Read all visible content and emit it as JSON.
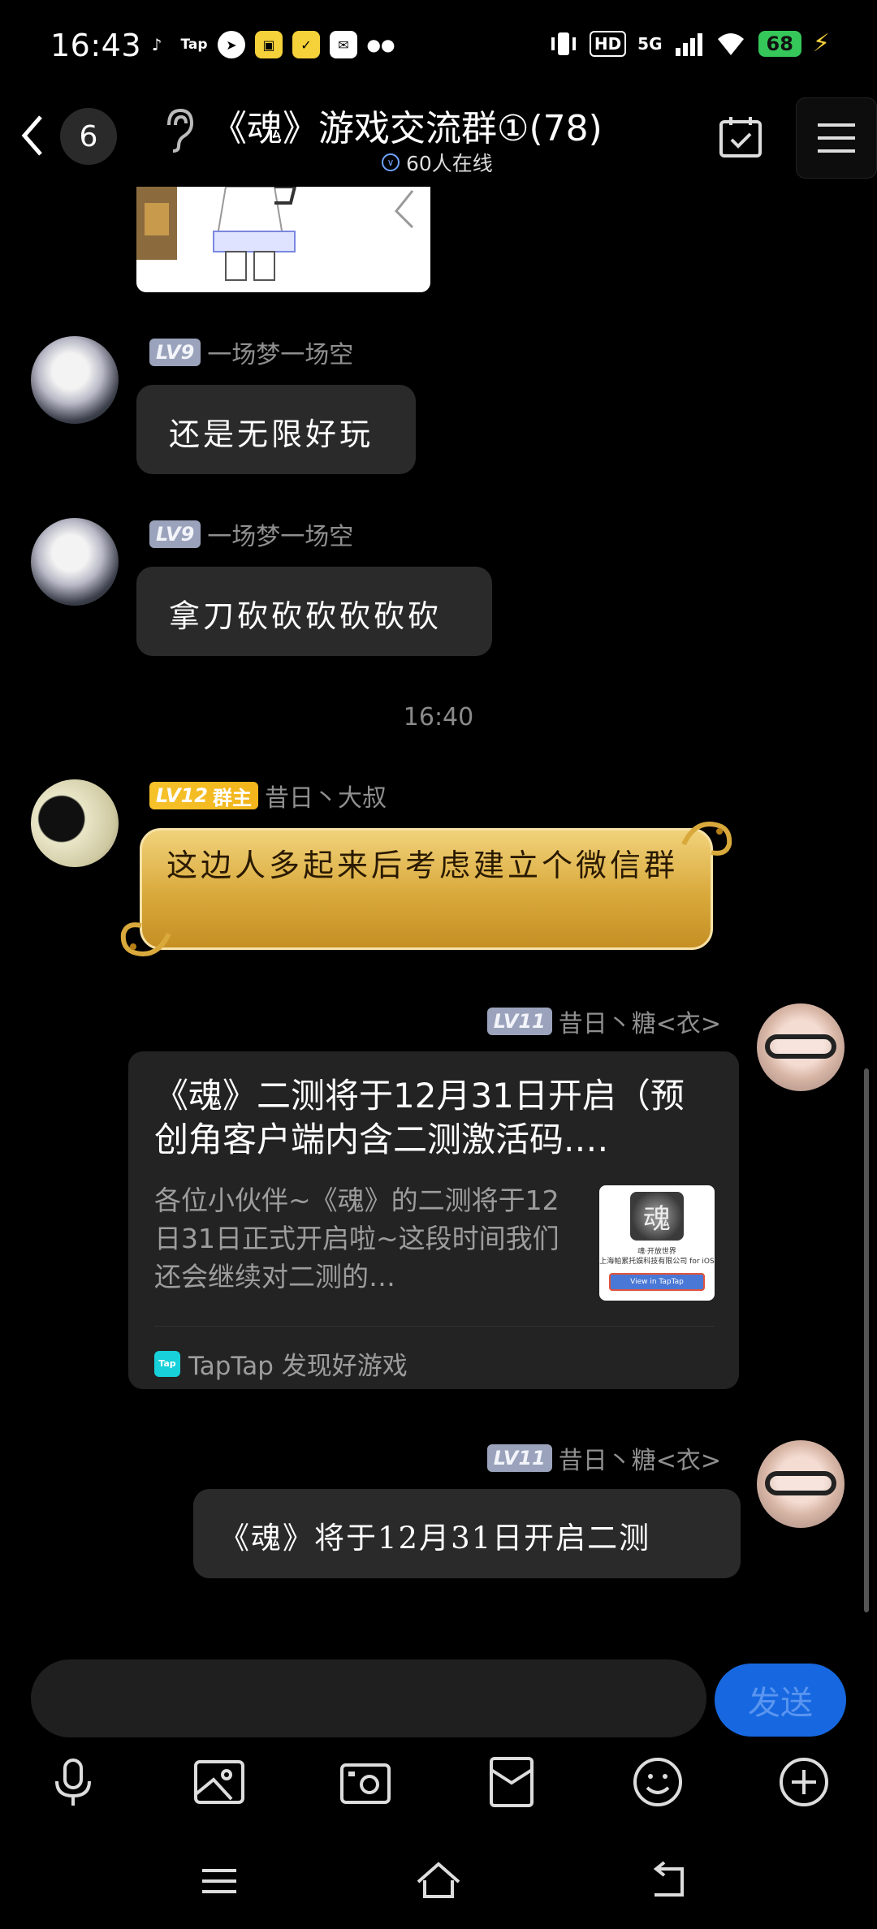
{
  "status_bar": {
    "time": "16:43",
    "apps": [
      "tiktok-icon",
      "Tap",
      "speed-icon",
      "eleme-icon",
      "Q",
      "mail-icon",
      "wechat-icon"
    ],
    "app_tap_label": "Tap",
    "hd_label": "HD",
    "network_label": "5G",
    "battery": "68"
  },
  "header": {
    "unread_count": "6",
    "title": "《魂》游戏交流群①(78)",
    "online": "60人在线"
  },
  "messages": [
    {
      "level": "LV9",
      "name": "一场梦一场空",
      "text": "还是无限好玩"
    },
    {
      "level": "LV9",
      "name": "一场梦一场空",
      "text": "拿刀砍砍砍砍砍砍"
    },
    {
      "timestamp": "16:40"
    },
    {
      "level": "LV12",
      "role": "群主",
      "name": "昔日丶大叔",
      "text": "这边人多起来后考虑建立个微信群"
    },
    {
      "level": "LV11",
      "name": "昔日丶糖<衣>",
      "card": {
        "title": "《魂》二测将于12月31日开启（预创角客户端内含二测激活码.…",
        "description": "各位小伙伴~《魂》的二测将于12日31日正式开启啦~这段时间我们还会继续对二测的…",
        "thumb_char": "魂",
        "thumb_line1": "魂·开放世界",
        "thumb_line2": "上海帕累托娱科技有限公司 for iOS",
        "thumb_button": "View in TapTap",
        "source_logo": "Tap",
        "source": "TapTap 发现好游戏"
      }
    },
    {
      "level": "LV11",
      "name": "昔日丶糖<衣>",
      "text": "《魂》将于12月31日开启二测"
    }
  ],
  "input": {
    "placeholder": "",
    "send_label": "发送"
  },
  "toolbar": [
    "microphone-icon",
    "image-icon",
    "camera-icon",
    "red-packet-icon",
    "emoji-icon",
    "plus-icon"
  ],
  "colors": {
    "accent": "#1768e0",
    "bubble": "#2a2a2a",
    "background": "#000000",
    "owner_badge": "#f6c22b"
  }
}
